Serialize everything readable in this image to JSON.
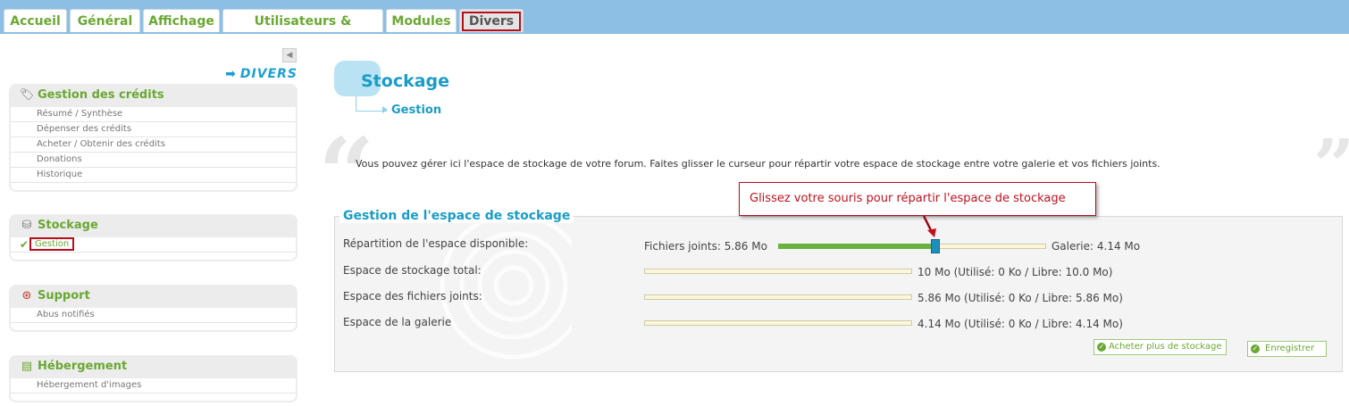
{
  "tabs": [
    "Accueil",
    "Général",
    "Affichage",
    "Utilisateurs & Groupes",
    "Modules",
    "Divers"
  ],
  "active_tab": "Divers",
  "sidebar": {
    "section_label": "DIVERS",
    "panels": [
      {
        "title": "Gestion des crédits",
        "icon": "credits-icon",
        "items": [
          "Résumé / Synthèse",
          "Dépenser des crédits",
          "Acheter / Obtenir des crédits",
          "Donations",
          "Historique"
        ]
      },
      {
        "title": "Stockage",
        "icon": "storage-icon",
        "items": [
          "Gestion"
        ]
      },
      {
        "title": "Support",
        "icon": "lifebuoy-icon",
        "items": [
          "Abus notifiés"
        ]
      },
      {
        "title": "Hébergement",
        "icon": "images-icon",
        "items": [
          "Hébergement d'images"
        ]
      }
    ]
  },
  "main": {
    "title": "Stockage",
    "subtitle": "Gestion",
    "description": "Vous pouvez gérer ici l'espace de stockage de votre forum. Faites glisser le curseur pour répartir votre espace de stockage entre votre galerie et vos fichiers joints.",
    "fieldset_title": "Gestion de l'espace de stockage",
    "tooltip": "Glissez votre souris pour répartir l'espace de stockage",
    "slider": {
      "label": "Répartition de l'espace disponible:",
      "left_text": "Fichiers joints: 5.86 Mo",
      "right_text": "Galerie: 4.14 Mo",
      "fraction": 0.586
    },
    "rows": [
      {
        "label": "Espace de stockage total:",
        "value": "10 Mo (Utilisé: 0 Ko / Libre: 10.0 Mo)"
      },
      {
        "label": "Espace des fichiers joints:",
        "value": "5.86 Mo (Utilisé: 0 Ko / Libre: 5.86 Mo)"
      },
      {
        "label": "Espace de la galerie",
        "value": "4.14 Mo (Utilisé: 0 Ko / Libre: 4.14 Mo)"
      }
    ],
    "buttons": {
      "buy": "Acheter plus de stockage",
      "save": "Enregistrer"
    }
  },
  "colors": {
    "accent": "#1a9cc8",
    "green": "#6aa832",
    "highlight": "#b80e1c",
    "topbar": "#8dbfe4"
  }
}
